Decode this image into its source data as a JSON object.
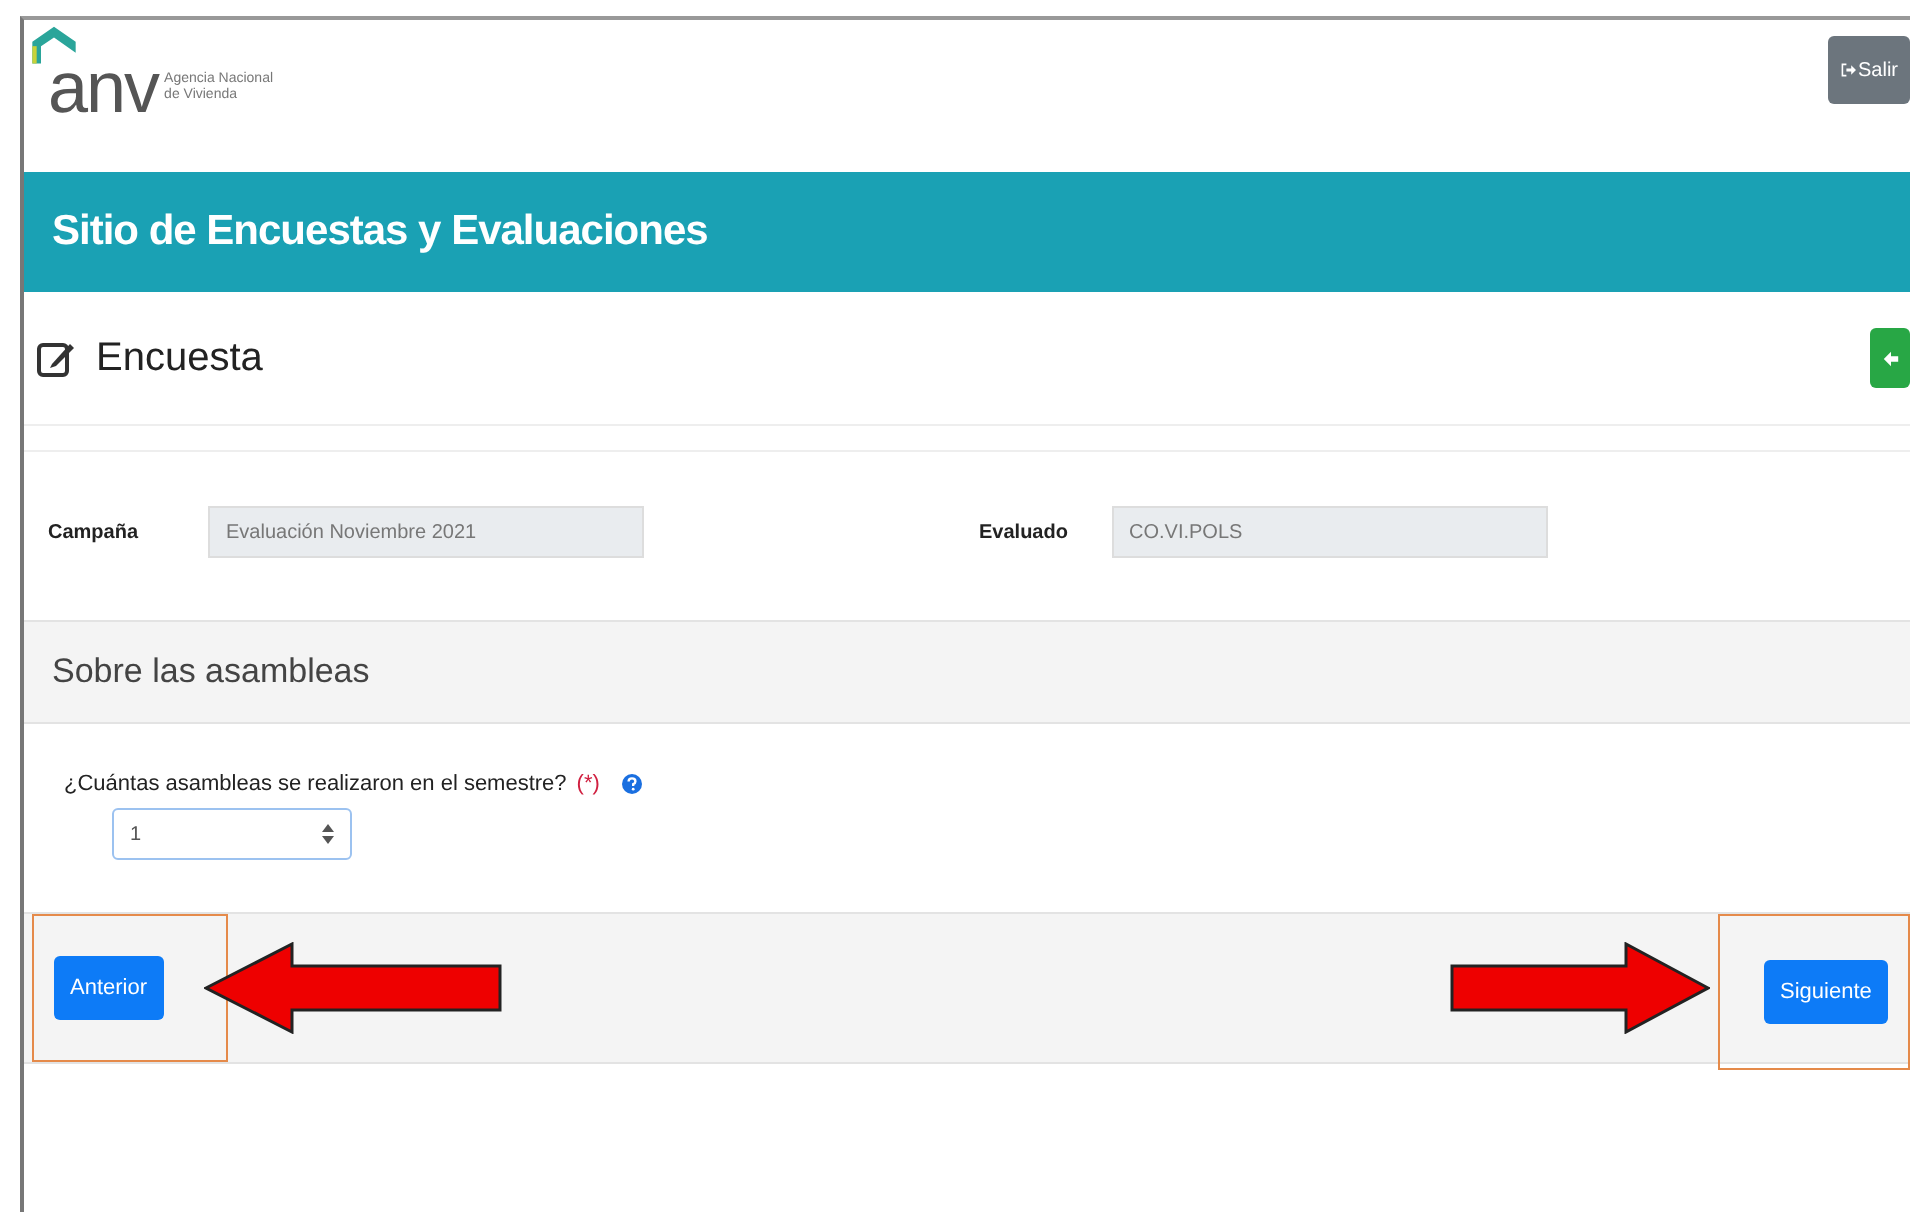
{
  "header": {
    "logo_text": "anv",
    "logo_subtitle": [
      "Agencia Nacional",
      "de Vivienda"
    ],
    "logout_button": "Salir"
  },
  "banner": {
    "title": "Sitio de Encuestas y Evaluaciones"
  },
  "page": {
    "title": "Encuesta"
  },
  "fields": [
    {
      "label": "Campaña",
      "value": "Evaluación Noviembre 2021"
    },
    {
      "label": "Evaluado",
      "value": "CO.VI.POLS"
    }
  ],
  "section": {
    "title": "Sobre las asambleas"
  },
  "question": {
    "label": "¿Cuántas asambleas se realizaron en el semestre?",
    "required_mark": "(*)",
    "value": "1"
  },
  "nav": {
    "previous": "Anterior",
    "next": "Siguiente"
  }
}
